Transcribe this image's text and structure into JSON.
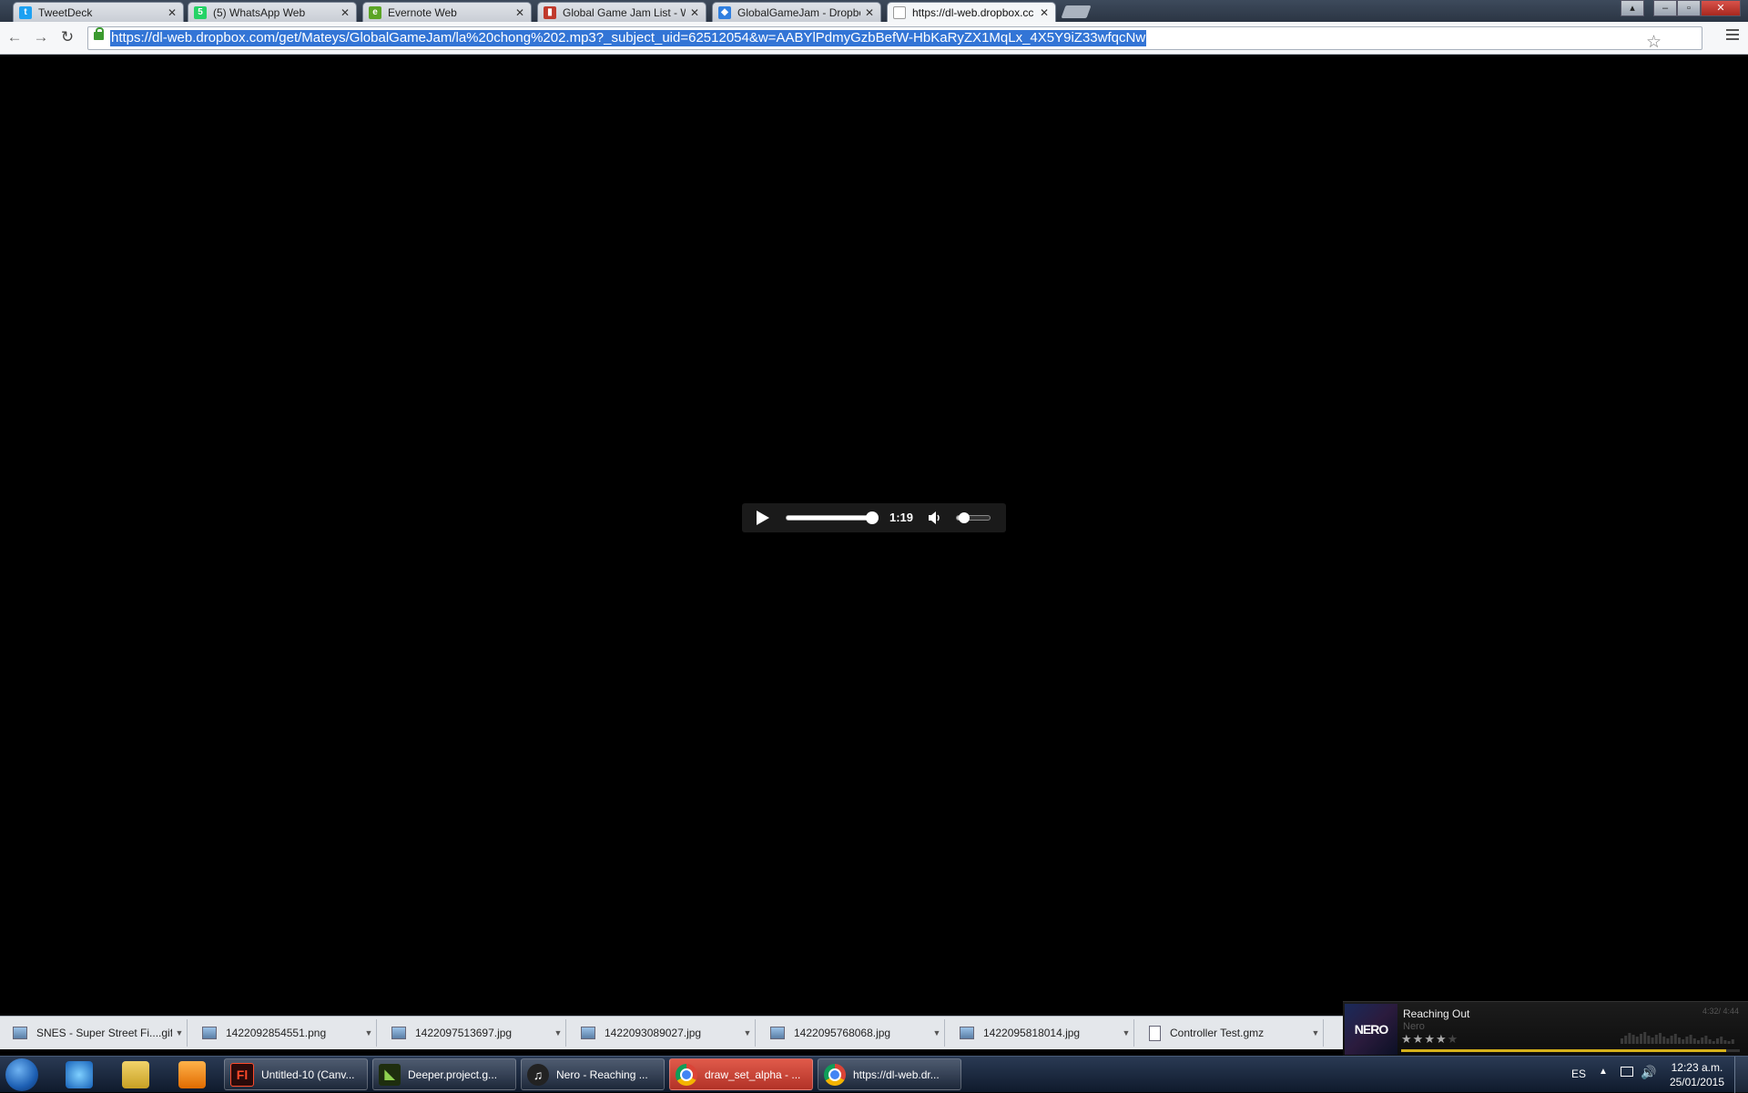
{
  "tabs": [
    {
      "title": "TweetDeck",
      "icon": "twitter-icon",
      "color": "#1da1f2",
      "glyph": "t"
    },
    {
      "title": "(5) WhatsApp Web",
      "icon": "whatsapp-icon",
      "color": "#25d366",
      "glyph": "5"
    },
    {
      "title": "Evernote Web",
      "icon": "evernote-icon",
      "color": "#5ba525",
      "glyph": "e"
    },
    {
      "title": "Global Game Jam List - Wi",
      "icon": "bookmark-icon",
      "color": "#c0392b",
      "glyph": "▮"
    },
    {
      "title": "GlobalGameJam - Dropbo",
      "icon": "dropbox-icon",
      "color": "#2f7fe0",
      "glyph": "◆"
    },
    {
      "title": "https://dl-web.dropbox.cc",
      "icon": "page-icon",
      "color": "#ffffff",
      "glyph": ""
    }
  ],
  "address_bar": {
    "url": "https://dl-web.dropbox.com/get/Mateys/GlobalGameJam/la%20chong%202.mp3?_subject_uid=62512054&w=AABYlPdmyGzbBefW-HbKaRyZX1MqLx_4X5Y9iZ33wfqcNw"
  },
  "player": {
    "time": "1:19",
    "progress": 0.96,
    "volume": 0.2
  },
  "downloads": [
    {
      "name": "SNES - Super Street Fi....gif",
      "icon": "image-file-icon"
    },
    {
      "name": "1422092854551.png",
      "icon": "image-file-icon"
    },
    {
      "name": "1422097513697.jpg",
      "icon": "image-file-icon"
    },
    {
      "name": "1422093089027.jpg",
      "icon": "image-file-icon"
    },
    {
      "name": "1422095768068.jpg",
      "icon": "image-file-icon"
    },
    {
      "name": "1422095818014.jpg",
      "icon": "image-file-icon"
    },
    {
      "name": "Controller Test.gmz",
      "icon": "document-file-icon"
    }
  ],
  "now_playing": {
    "art_text": "NERO",
    "song": "Reaching Out",
    "artist": "Nero",
    "duration": "4:32/ 4:44",
    "rating": 4,
    "progress": 0.96
  },
  "taskbar": {
    "buttons": [
      {
        "label": "Untitled-10 (Canv...",
        "icon": "flash-icon",
        "glyph": "Fl",
        "bg": "#2a0a0a",
        "fg": "#ff4a2a",
        "red": false
      },
      {
        "label": "Deeper.project.g...",
        "icon": "gamemaker-icon",
        "glyph": "◣",
        "bg": "#1e2e0e",
        "fg": "#8fd14f",
        "red": false
      },
      {
        "label": "Nero - Reaching ...",
        "icon": "media-player-icon",
        "glyph": "♫",
        "bg": "#222",
        "fg": "#fff",
        "red": false
      },
      {
        "label": "draw_set_alpha - ...",
        "icon": "chrome-icon",
        "glyph": "",
        "bg": "",
        "fg": "",
        "red": true
      },
      {
        "label": "https://dl-web.dr...",
        "icon": "chrome-icon",
        "glyph": "",
        "bg": "",
        "fg": "",
        "red": false
      }
    ],
    "language": "ES",
    "time": "12:23 a.m.",
    "date": "25/01/2015"
  }
}
